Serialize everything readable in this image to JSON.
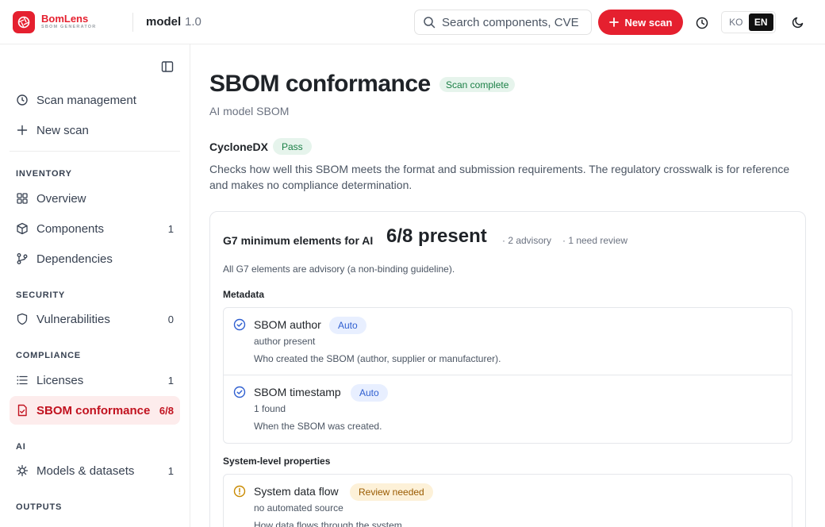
{
  "brand": {
    "name": "BomLens",
    "tagline": "SBOM GENERATOR"
  },
  "project": {
    "name": "model",
    "version": "1.0"
  },
  "search": {
    "placeholder": "Search components, CVE"
  },
  "header": {
    "new_scan_label": "New scan",
    "lang_ko": "KO",
    "lang_en": "EN",
    "active_lang": "EN"
  },
  "sidebar": {
    "top": [
      {
        "label": "Scan management",
        "icon": "history-icon"
      },
      {
        "label": "New scan",
        "icon": "plus-icon"
      }
    ],
    "sections": {
      "inventory": "INVENTORY",
      "security": "SECURITY",
      "compliance": "COMPLIANCE",
      "ai": "AI",
      "outputs": "OUTPUTS"
    },
    "items": {
      "overview": {
        "label": "Overview",
        "count": ""
      },
      "components": {
        "label": "Components",
        "count": "1"
      },
      "dependencies": {
        "label": "Dependencies",
        "count": ""
      },
      "vulnerabilities": {
        "label": "Vulnerabilities",
        "count": "0"
      },
      "licenses": {
        "label": "Licenses",
        "count": "1"
      },
      "conformance": {
        "label": "SBOM conformance",
        "count": "6/8"
      },
      "models": {
        "label": "Models & datasets",
        "count": "1"
      }
    },
    "active_item": "SBOM conformance"
  },
  "main": {
    "title": "SBOM conformance",
    "status_badge": "Scan complete",
    "subtitle": "AI model SBOM",
    "format": {
      "name": "CycloneDX",
      "result": "Pass"
    },
    "description": "Checks how well this SBOM meets the format and submission requirements. The regulatory crosswalk is for reference and makes no compliance determination.",
    "g7": {
      "title": "G7 minimum elements for AI",
      "present": "6/8 present",
      "advisory": "· 2 advisory",
      "review": "· 1 need review",
      "note": "All G7 elements are advisory (a non-binding guideline).",
      "groups": [
        {
          "label": "Metadata",
          "rows": [
            {
              "name": "SBOM author",
              "tag": "Auto",
              "detail": "author present",
              "explain": "Who created the SBOM (author, supplier or manufacturer).",
              "status": "ok"
            },
            {
              "name": "SBOM timestamp",
              "tag": "Auto",
              "detail": "1 found",
              "explain": "When the SBOM was created.",
              "status": "ok"
            }
          ]
        },
        {
          "label": "System-level properties",
          "rows": [
            {
              "name": "System data flow",
              "tag": "Review needed",
              "detail": "no automated source",
              "explain": "How data flows through the system.",
              "status": "review"
            }
          ]
        }
      ]
    }
  },
  "colors": {
    "accent": "#e5202f",
    "active_bg": "#fdecec",
    "ok": "#2f5fd0",
    "warn": "#c98a00",
    "pass_bg": "#e6f4ec",
    "pass_fg": "#1a7f45"
  }
}
